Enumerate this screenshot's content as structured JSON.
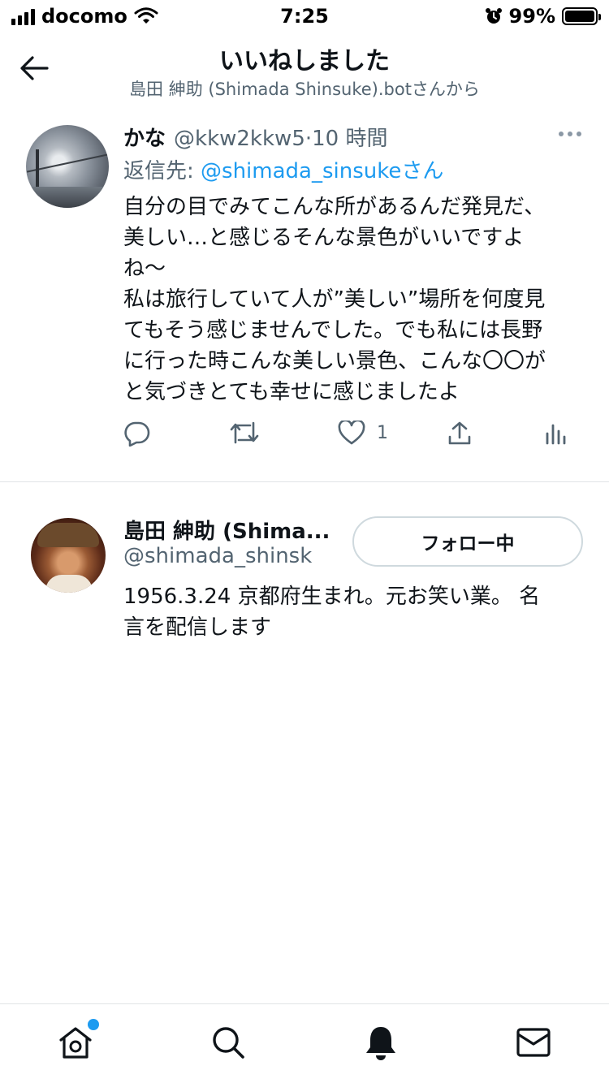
{
  "status_bar": {
    "carrier": "docomo",
    "time": "7:25",
    "battery_percent": "99%",
    "battery_level": 0.99,
    "icons": [
      "signal-icon",
      "wifi-icon",
      "alarm-icon",
      "battery-icon"
    ]
  },
  "header": {
    "title": "いいねしました",
    "subtitle": "島田 紳助 (Shimada Shinsuke).botさんから",
    "back_icon": "arrow-left-icon"
  },
  "tweet": {
    "author_name": "かな",
    "author_handle": "@kkw2kkw5",
    "separator": "·",
    "time_ago": "10 時間",
    "reply_prefix": "返信先: ",
    "reply_mention": "@shimada_sinsuke",
    "reply_suffix": "さん",
    "body_lines": [
      "自分の目でみてこんな所があるんだ発見だ、",
      "美しい…と感じるそんな景色がいいですよ",
      "ね～",
      "私は旅行していて人が”美しい”場所を何度見",
      "てもそう感じませんでした。でも私には長野",
      "に行った時こんな美しい景色、こんな〇〇が",
      "と気づきとても幸せに感じましたよ"
    ],
    "like_count": "1",
    "actions": [
      "reply-icon",
      "retweet-icon",
      "like-icon",
      "share-icon",
      "analytics-icon"
    ]
  },
  "user_card": {
    "name": "島田 紳助 (Shima...",
    "handle": "@shimada_shinsk",
    "follow_label": "フォロー中",
    "bio_lines": [
      "1956.3.24 京都府生まれ。元お笑い業。 名",
      "言を配信します"
    ]
  },
  "tab_bar": {
    "items": [
      "home-icon",
      "search-icon",
      "notifications-icon",
      "messages-icon"
    ],
    "accent": "#1d9bf0"
  },
  "colors": {
    "text": "#0f1419",
    "secondary": "#536471",
    "link": "#1d9bf0",
    "border": "#e1e4e6"
  }
}
